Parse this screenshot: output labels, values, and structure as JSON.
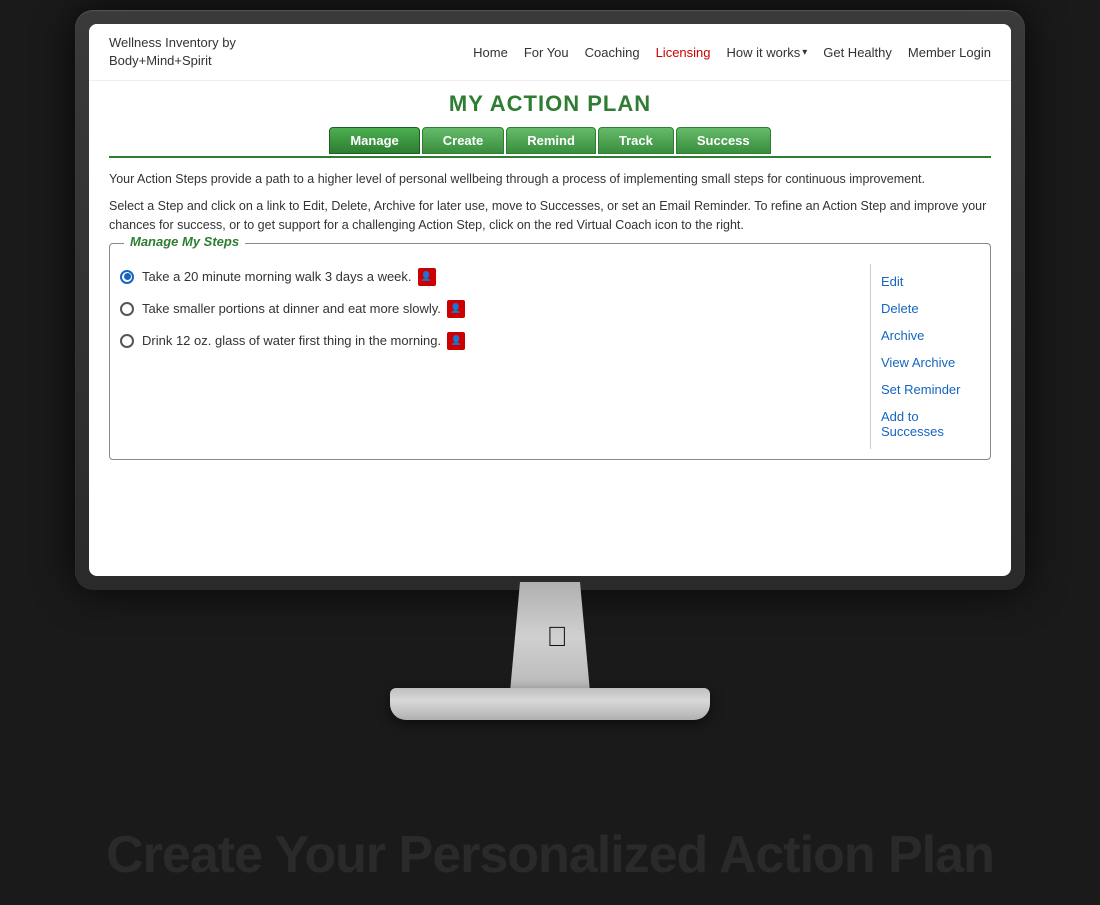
{
  "monitor": {
    "apple_symbol": ""
  },
  "bottom_text": "Create Your Personalized Action Plan",
  "site": {
    "logo_line1": "Wellness Inventory by",
    "logo_line2": "Body+Mind+Spirit",
    "nav": {
      "home": "Home",
      "for_you": "For You",
      "coaching": "Coaching",
      "licensing": "Licensing",
      "how_it_works": "How it works",
      "get_healthy": "Get Healthy",
      "member_login": "Member Login"
    },
    "page_title": "MY ACTION PLAN",
    "tabs": [
      {
        "label": "Manage",
        "active": true
      },
      {
        "label": "Create",
        "active": false
      },
      {
        "label": "Remind",
        "active": false
      },
      {
        "label": "Track",
        "active": false
      },
      {
        "label": "Success",
        "active": false
      }
    ],
    "description1": "Your Action Steps provide a path to a higher level of personal wellbeing through a process of implementing small steps for continuous improvement.",
    "description2": "Select a Step and click on a link to Edit, Delete, Archive for later use, move to Successes, or set an Email Reminder. To refine an Action Step and improve your chances for success, or to get support for a challenging Action Step, click on the red Virtual Coach icon to the right.",
    "manage_legend": "Manage My Steps",
    "steps": [
      {
        "text": "Take a 20 minute morning walk 3 days a week.",
        "selected": true
      },
      {
        "text": "Take smaller portions at dinner and eat more slowly.",
        "selected": false
      },
      {
        "text": "Drink 12 oz. glass of water first thing in the morning.",
        "selected": false
      }
    ],
    "actions": [
      {
        "label": "Edit"
      },
      {
        "label": "Delete"
      },
      {
        "label": "Archive"
      },
      {
        "label": "View Archive"
      },
      {
        "label": "Set Reminder"
      },
      {
        "label": "Add to Successes"
      }
    ]
  }
}
